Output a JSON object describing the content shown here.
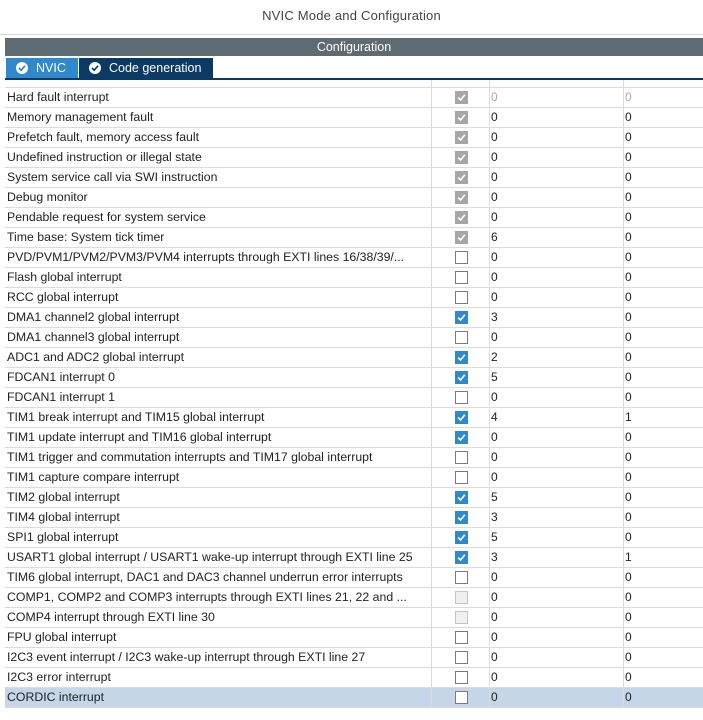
{
  "window": {
    "title": "NVIC Mode and Configuration"
  },
  "configuration": {
    "label": "Configuration"
  },
  "tabs": [
    {
      "label": "NVIC",
      "active": true
    },
    {
      "label": "Code generation",
      "active": false
    }
  ],
  "colors": {
    "accent": "#2f89cc",
    "tab_dark": "#0b3a64",
    "header": "#5f6b73",
    "selected_row": "#c4d6e8"
  },
  "rows": [
    {
      "name": "Hard fault interrupt",
      "state": "checked-grey",
      "preemption": "0",
      "sub": "0",
      "dim": true
    },
    {
      "name": "Memory management fault",
      "state": "checked-grey",
      "preemption": "0",
      "sub": "0"
    },
    {
      "name": "Prefetch fault, memory access fault",
      "state": "checked-grey",
      "preemption": "0",
      "sub": "0"
    },
    {
      "name": "Undefined instruction or illegal state",
      "state": "checked-grey",
      "preemption": "0",
      "sub": "0"
    },
    {
      "name": "System service call via SWI instruction",
      "state": "checked-grey",
      "preemption": "0",
      "sub": "0"
    },
    {
      "name": "Debug monitor",
      "state": "checked-grey",
      "preemption": "0",
      "sub": "0"
    },
    {
      "name": "Pendable request for system service",
      "state": "checked-grey",
      "preemption": "0",
      "sub": "0"
    },
    {
      "name": "Time base: System tick timer",
      "state": "checked-grey",
      "preemption": "6",
      "sub": "0"
    },
    {
      "name": "PVD/PVM1/PVM2/PVM3/PVM4 interrupts through EXTI lines 16/38/39/...",
      "state": "unchecked",
      "preemption": "0",
      "sub": "0"
    },
    {
      "name": "Flash global interrupt",
      "state": "unchecked",
      "preemption": "0",
      "sub": "0"
    },
    {
      "name": "RCC global interrupt",
      "state": "unchecked",
      "preemption": "0",
      "sub": "0"
    },
    {
      "name": "DMA1 channel2 global interrupt",
      "state": "checked",
      "preemption": "3",
      "sub": "0"
    },
    {
      "name": "DMA1 channel3 global interrupt",
      "state": "unchecked",
      "preemption": "0",
      "sub": "0"
    },
    {
      "name": "ADC1 and ADC2 global interrupt",
      "state": "checked",
      "preemption": "2",
      "sub": "0"
    },
    {
      "name": "FDCAN1 interrupt 0",
      "state": "checked",
      "preemption": "5",
      "sub": "0"
    },
    {
      "name": "FDCAN1 interrupt 1",
      "state": "unchecked",
      "preemption": "0",
      "sub": "0"
    },
    {
      "name": "TIM1 break interrupt and TIM15 global interrupt",
      "state": "checked",
      "preemption": "4",
      "sub": "1"
    },
    {
      "name": "TIM1 update interrupt and TIM16 global interrupt",
      "state": "checked",
      "preemption": "0",
      "sub": "0"
    },
    {
      "name": "TIM1 trigger and commutation interrupts and TIM17 global interrupt",
      "state": "unchecked",
      "preemption": "0",
      "sub": "0"
    },
    {
      "name": "TIM1 capture compare interrupt",
      "state": "unchecked",
      "preemption": "0",
      "sub": "0"
    },
    {
      "name": "TIM2 global interrupt",
      "state": "checked",
      "preemption": "5",
      "sub": "0"
    },
    {
      "name": "TIM4 global interrupt",
      "state": "checked",
      "preemption": "3",
      "sub": "0"
    },
    {
      "name": "SPI1 global interrupt",
      "state": "checked",
      "preemption": "5",
      "sub": "0"
    },
    {
      "name": "USART1 global interrupt / USART1 wake-up interrupt through EXTI line 25",
      "state": "checked",
      "preemption": "3",
      "sub": "1"
    },
    {
      "name": "TIM6 global interrupt, DAC1 and DAC3 channel underrun error interrupts",
      "state": "unchecked",
      "preemption": "0",
      "sub": "0"
    },
    {
      "name": "COMP1, COMP2 and COMP3 interrupts through EXTI lines 21, 22 and ...",
      "state": "disabled",
      "preemption": "0",
      "sub": "0"
    },
    {
      "name": "COMP4 interrupt through EXTI line 30",
      "state": "disabled",
      "preemption": "0",
      "sub": "0"
    },
    {
      "name": "FPU global interrupt",
      "state": "unchecked",
      "preemption": "0",
      "sub": "0"
    },
    {
      "name": "I2C3 event interrupt / I2C3 wake-up interrupt through EXTI line 27",
      "state": "unchecked",
      "preemption": "0",
      "sub": "0"
    },
    {
      "name": "I2C3 error interrupt",
      "state": "unchecked",
      "preemption": "0",
      "sub": "0"
    },
    {
      "name": "CORDIC interrupt",
      "state": "unchecked",
      "preemption": "0",
      "sub": "0",
      "selected": true
    }
  ]
}
